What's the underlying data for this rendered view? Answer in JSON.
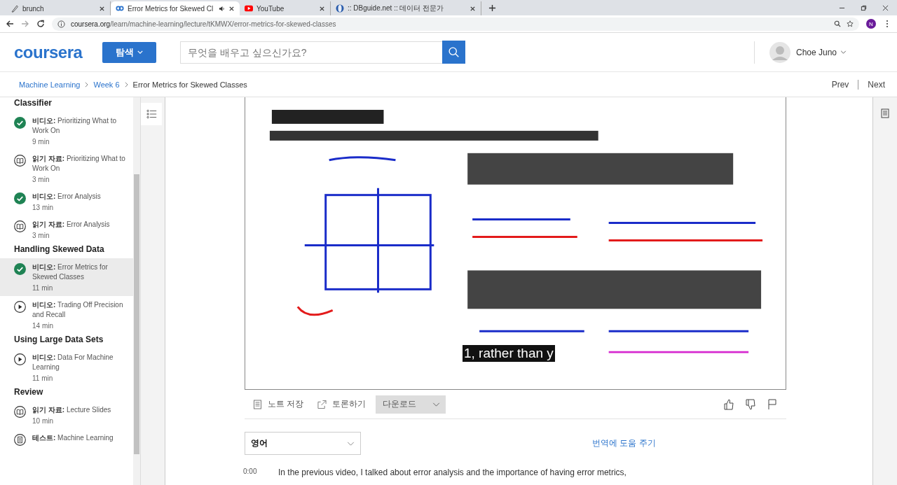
{
  "browser": {
    "tabs": [
      {
        "title": "brunch",
        "selected": false
      },
      {
        "title": "Error Metrics for Skewed Cl",
        "selected": true,
        "audio": true
      },
      {
        "title": "YouTube",
        "selected": false
      },
      {
        "title": ":: DBguide.net :: 데이터 전문가",
        "selected": false
      }
    ],
    "url_host": "coursera.org",
    "url_path": "/learn/machine-learning/lecture/tKMWX/error-metrics-for-skewed-classes",
    "profile_initial": "N"
  },
  "header": {
    "logo": "coursera",
    "explore": "탐색",
    "search_placeholder": "무엇을 배우고 싶으신가요?",
    "user": "Choe Juno"
  },
  "breadcrumb": {
    "items": [
      "Machine Learning",
      "Week 6",
      "Error Metrics for Skewed Classes"
    ],
    "prev": "Prev",
    "next": "Next"
  },
  "sidebar": {
    "sections": [
      {
        "title": "Classifier",
        "items": [
          {
            "done": true,
            "type": "비디오:",
            "title": "Prioritizing What to Work On",
            "duration": "9 min",
            "selected": false
          },
          {
            "kind": "reading",
            "done": false,
            "type": "읽기 자료:",
            "title": "Prioritizing What to Work On",
            "duration": "3 min",
            "selected": false
          },
          {
            "done": true,
            "type": "비디오:",
            "title": "Error Analysis",
            "duration": "13 min",
            "selected": false
          },
          {
            "kind": "reading",
            "done": false,
            "type": "읽기 자료:",
            "title": "Error Analysis",
            "duration": "3 min",
            "selected": false
          }
        ]
      },
      {
        "title": "Handling Skewed Data",
        "items": [
          {
            "done": true,
            "type": "비디오:",
            "title": "Error Metrics for Skewed Classes",
            "duration": "11 min",
            "selected": true
          },
          {
            "kind": "video",
            "done": false,
            "type": "비디오:",
            "title": "Trading Off Precision and Recall",
            "duration": "14 min",
            "selected": false
          }
        ]
      },
      {
        "title": "Using Large Data Sets",
        "items": [
          {
            "kind": "video",
            "done": false,
            "type": "비디오:",
            "title": "Data For Machine Learning",
            "duration": "11 min",
            "selected": false
          }
        ]
      },
      {
        "title": "Review",
        "items": [
          {
            "kind": "reading",
            "done": false,
            "type": "읽기 자료:",
            "title": "Lecture Slides",
            "duration": "10 min",
            "selected": false
          },
          {
            "kind": "quiz",
            "done": false,
            "type": "테스트:",
            "title": "Machine Learning",
            "selected": false
          }
        ]
      }
    ]
  },
  "video": {
    "caption": "1, rather than y"
  },
  "actions": {
    "save_note": "노트 저장",
    "discuss": "토론하기",
    "download": "다운로드"
  },
  "transcript": {
    "language": "영어",
    "help_translate": "번역에 도움 주기",
    "lines": [
      {
        "time": "0:00",
        "text": "In the previous video, I talked about error analysis and the importance of having error metrics,"
      }
    ]
  }
}
